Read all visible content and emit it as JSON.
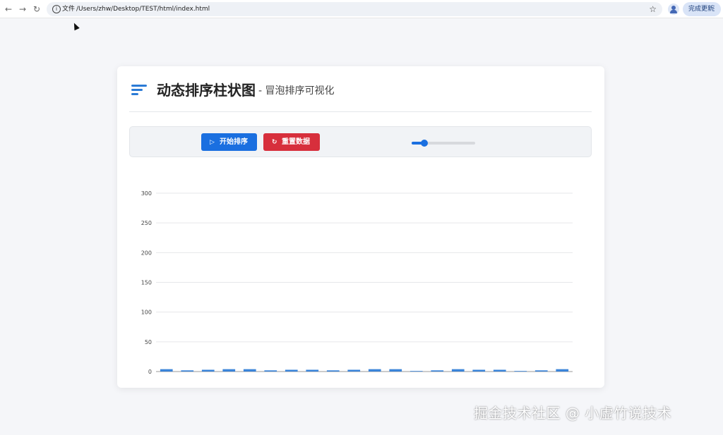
{
  "browser": {
    "file_label": "文件",
    "url": "/Users/zhw/Desktop/TEST/html/index.html",
    "update_label": "完成更新"
  },
  "header": {
    "title": "动态排序柱状图",
    "subtitle": "- 冒泡排序可视化"
  },
  "controls": {
    "start_label": "开始排序",
    "reset_label": "重置数据",
    "speed_value": 0.2
  },
  "chart_data": {
    "type": "bar",
    "ylim": [
      0,
      300
    ],
    "yticks": [
      0,
      50,
      100,
      150,
      200,
      250,
      300
    ],
    "grid": true,
    "values": [
      4,
      2,
      3,
      4,
      4,
      2,
      3,
      3,
      2,
      3,
      4,
      4,
      1,
      2,
      4,
      3,
      3,
      1,
      2,
      4
    ],
    "bar_color": "#3a84d9"
  },
  "watermark": "掘金技术社区 @ 小虚竹说技术"
}
